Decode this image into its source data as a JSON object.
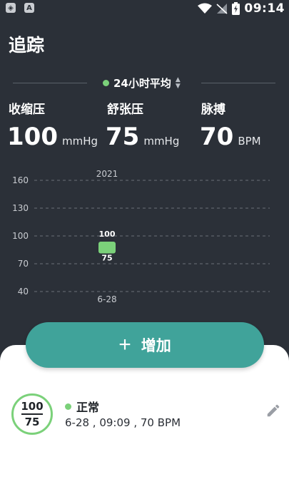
{
  "statusbar": {
    "time": "09:14",
    "app_badge": "A"
  },
  "header": {
    "title": "追踪"
  },
  "average": {
    "label": "24小时平均"
  },
  "stats": {
    "systolic": {
      "label": "收缩压",
      "value": "100",
      "unit": "mmHg"
    },
    "diastolic": {
      "label": "舒张压",
      "value": "75",
      "unit": "mmHg"
    },
    "pulse": {
      "label": "脉搏",
      "value": "70",
      "unit": "BPM"
    }
  },
  "chart_data": {
    "type": "bar",
    "year_label": "2021",
    "y_ticks": [
      160,
      130,
      100,
      70,
      40
    ],
    "categories": [
      "6-28"
    ],
    "series": [
      {
        "values": [
          {
            "low": 75,
            "high": 100
          }
        ]
      }
    ],
    "ylim": [
      40,
      160
    ],
    "grid": true
  },
  "add_button": {
    "label": "增加"
  },
  "record": {
    "systolic": "100",
    "diastolic": "75",
    "status": "正常",
    "detail": "6-28 , 09:09 , 70 BPM"
  },
  "colors": {
    "accent": "#40a39a",
    "normal": "#7bd17a",
    "background": "#2b3038"
  }
}
